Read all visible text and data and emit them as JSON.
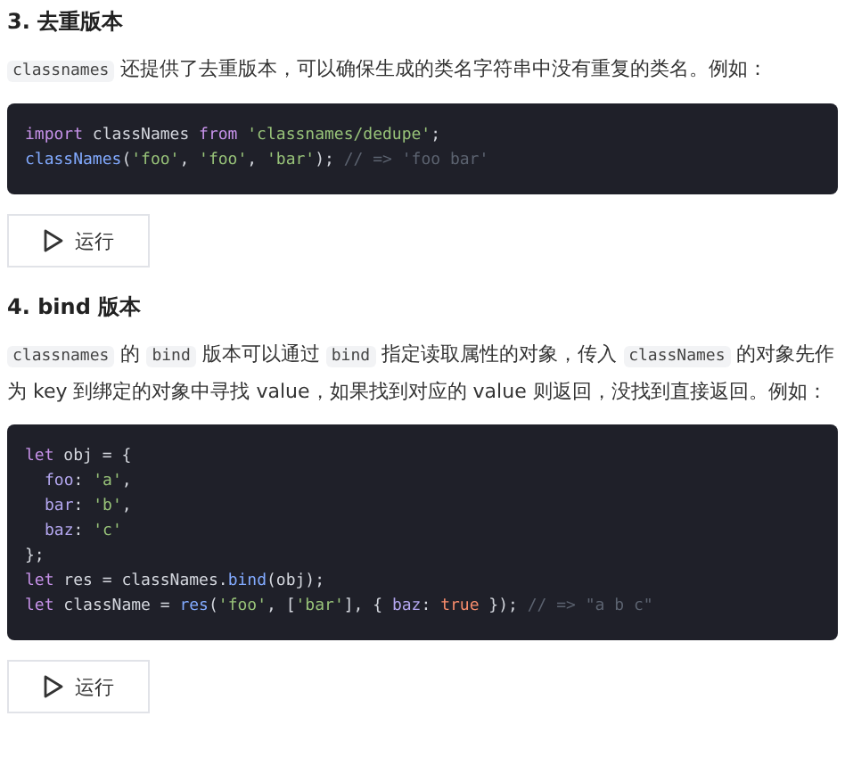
{
  "sections": [
    {
      "heading": "3. 去重版本",
      "paragraph": [
        {
          "kind": "code",
          "text": "classnames"
        },
        {
          "kind": "text",
          "text": " 还提供了去重版本，可以确保生成的类名字符串中没有重复的类名。例如："
        }
      ],
      "code": [
        {
          "indent": false,
          "tokens": [
            {
              "kind": "keyword",
              "text": "import"
            },
            {
              "kind": "plain",
              "text": " classNames "
            },
            {
              "kind": "keyword",
              "text": "from "
            },
            {
              "kind": "string",
              "text": "'classnames/dedupe'"
            },
            {
              "kind": "plain",
              "text": ";"
            }
          ]
        },
        {
          "indent": false,
          "tokens": [
            {
              "kind": "func",
              "text": "classNames"
            },
            {
              "kind": "plain",
              "text": "("
            },
            {
              "kind": "string",
              "text": "'foo'"
            },
            {
              "kind": "plain",
              "text": ", "
            },
            {
              "kind": "string",
              "text": "'foo'"
            },
            {
              "kind": "plain",
              "text": ", "
            },
            {
              "kind": "string",
              "text": "'bar'"
            },
            {
              "kind": "plain",
              "text": "); "
            },
            {
              "kind": "comment",
              "text": "// => 'foo bar'"
            }
          ]
        }
      ],
      "button": {
        "label": "运行"
      }
    },
    {
      "heading": "4. bind 版本",
      "paragraph": [
        {
          "kind": "code",
          "text": "classnames"
        },
        {
          "kind": "text",
          "text": " 的 "
        },
        {
          "kind": "code",
          "text": "bind"
        },
        {
          "kind": "text",
          "text": " 版本可以通过 "
        },
        {
          "kind": "code",
          "text": "bind"
        },
        {
          "kind": "text",
          "text": " 指定读取属性的对象，传入 "
        },
        {
          "kind": "code",
          "text": "classNames"
        },
        {
          "kind": "text",
          "text": " 的对象先作为 key 到绑定的对象中寻找 value，如果找到对应的 value 则返回，没找到直接返回。例如："
        }
      ],
      "code": [
        {
          "indent": false,
          "tokens": [
            {
              "kind": "keyword",
              "text": "let"
            },
            {
              "kind": "plain",
              "text": " obj = {"
            }
          ]
        },
        {
          "indent": true,
          "tokens": [
            {
              "kind": "prop",
              "text": "foo"
            },
            {
              "kind": "plain",
              "text": ": "
            },
            {
              "kind": "string",
              "text": "'a'"
            },
            {
              "kind": "plain",
              "text": ","
            }
          ]
        },
        {
          "indent": true,
          "tokens": [
            {
              "kind": "prop",
              "text": "bar"
            },
            {
              "kind": "plain",
              "text": ": "
            },
            {
              "kind": "string",
              "text": "'b'"
            },
            {
              "kind": "plain",
              "text": ","
            }
          ]
        },
        {
          "indent": true,
          "tokens": [
            {
              "kind": "prop",
              "text": "baz"
            },
            {
              "kind": "plain",
              "text": ": "
            },
            {
              "kind": "string",
              "text": "'c'"
            }
          ]
        },
        {
          "indent": false,
          "tokens": [
            {
              "kind": "plain",
              "text": "};"
            }
          ]
        },
        {
          "indent": false,
          "tokens": [
            {
              "kind": "keyword",
              "text": "let"
            },
            {
              "kind": "plain",
              "text": " res = classNames."
            },
            {
              "kind": "func",
              "text": "bind"
            },
            {
              "kind": "plain",
              "text": "(obj);"
            }
          ]
        },
        {
          "indent": false,
          "tokens": [
            {
              "kind": "keyword",
              "text": "let"
            },
            {
              "kind": "plain",
              "text": " className = "
            },
            {
              "kind": "func",
              "text": "res"
            },
            {
              "kind": "plain",
              "text": "("
            },
            {
              "kind": "string",
              "text": "'foo'"
            },
            {
              "kind": "plain",
              "text": ", ["
            },
            {
              "kind": "string",
              "text": "'bar'"
            },
            {
              "kind": "plain",
              "text": "], { "
            },
            {
              "kind": "prop",
              "text": "baz"
            },
            {
              "kind": "plain",
              "text": ": "
            },
            {
              "kind": "bool",
              "text": "true"
            },
            {
              "kind": "plain",
              "text": " }); "
            },
            {
              "kind": "comment",
              "text": "// => \"a b c\""
            }
          ]
        }
      ],
      "button": {
        "label": "运行"
      }
    }
  ]
}
